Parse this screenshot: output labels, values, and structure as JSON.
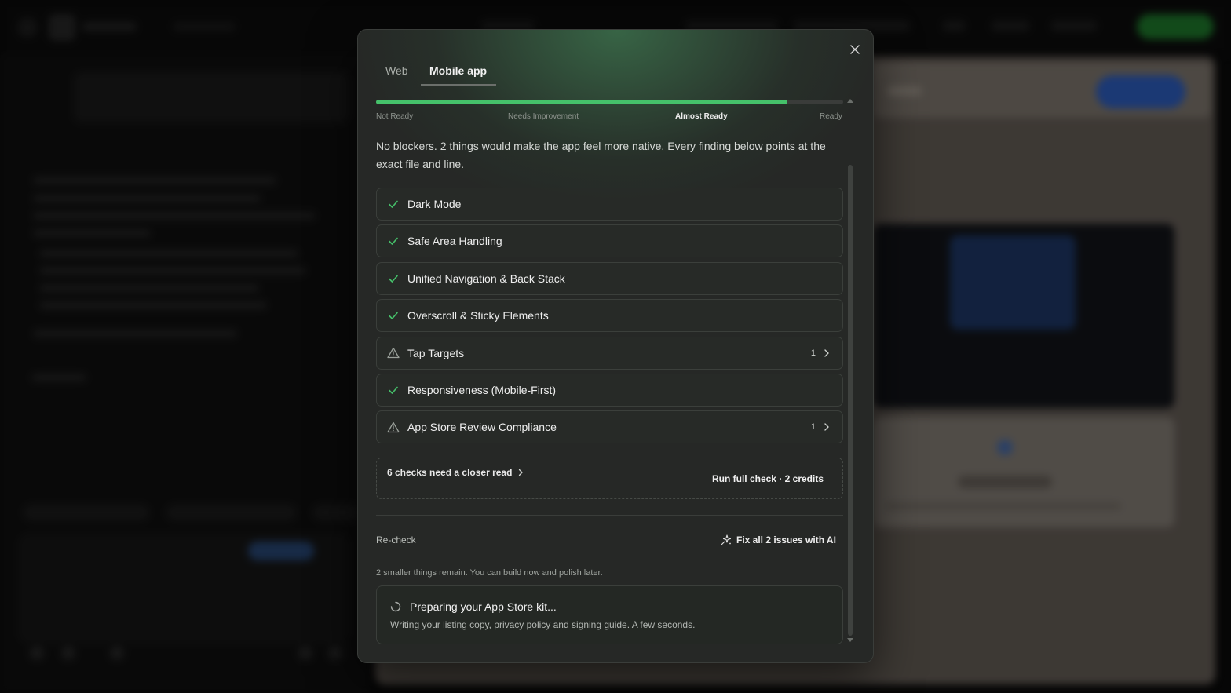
{
  "tabs": [
    {
      "label": "Web",
      "active": false
    },
    {
      "label": "Mobile app",
      "active": true
    }
  ],
  "readiness": {
    "progress_percent": 88,
    "stages": [
      "Not Ready",
      "Needs Improvement",
      "Almost Ready",
      "Ready"
    ],
    "current_stage": "Almost Ready"
  },
  "summary": "No blockers. 2 things would make the app feel more native. Every finding below points at the exact file and line.",
  "checks": [
    {
      "label": "Dark Mode",
      "status": "pass",
      "icon": "check-icon"
    },
    {
      "label": "Safe Area Handling",
      "status": "pass",
      "icon": "check-icon"
    },
    {
      "label": "Unified Navigation & Back Stack",
      "status": "pass",
      "icon": "check-icon"
    },
    {
      "label": "Overscroll & Sticky Elements",
      "status": "pass",
      "icon": "check-icon"
    },
    {
      "label": "Tap Targets",
      "status": "warning",
      "icon": "warning-icon",
      "count": "1"
    },
    {
      "label": "Responsiveness (Mobile-First)",
      "status": "pass",
      "icon": "check-icon"
    },
    {
      "label": "App Store Review Compliance",
      "status": "warning",
      "icon": "warning-icon",
      "count": "1"
    }
  ],
  "closer_read": {
    "link_label": "6 checks need a closer read",
    "run_full_label": "Run full check · 2 credits"
  },
  "actions": {
    "recheck_label": "Re-check",
    "fix_all_label": "Fix all 2 issues with AI"
  },
  "remaining_note": "2 smaller things remain. You can build now and polish later.",
  "kit": {
    "title": "Preparing your App Store kit...",
    "subtitle": "Writing your listing copy, privacy policy and signing guide. A few seconds."
  },
  "colors": {
    "accent_green": "#45c16a",
    "warning_gray": "#9aa09a",
    "modal_bg": "#262826"
  }
}
